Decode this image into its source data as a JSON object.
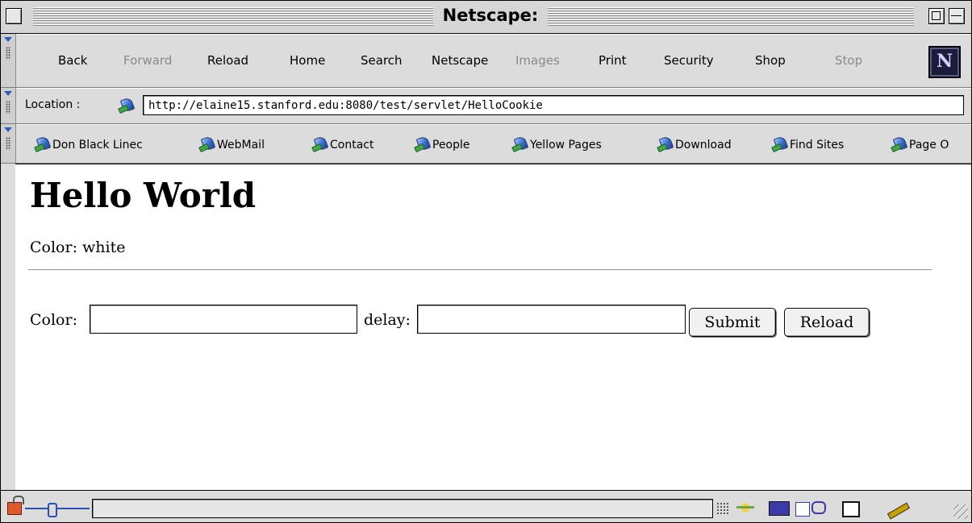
{
  "window": {
    "title": "Netscape:"
  },
  "nav_toolbar": {
    "buttons": [
      {
        "label": "Back",
        "enabled": true
      },
      {
        "label": "Forward",
        "enabled": false
      },
      {
        "label": "Reload",
        "enabled": true
      },
      {
        "label": "Home",
        "enabled": true
      },
      {
        "label": "Search",
        "enabled": true
      },
      {
        "label": "Netscape",
        "enabled": true
      },
      {
        "label": "Images",
        "enabled": false
      },
      {
        "label": "Print",
        "enabled": true
      },
      {
        "label": "Security",
        "enabled": true
      },
      {
        "label": "Shop",
        "enabled": true
      },
      {
        "label": "Stop",
        "enabled": false
      }
    ],
    "logo_letter": "N"
  },
  "location_bar": {
    "label": "Location :",
    "url": "http://elaine15.stanford.edu:8080/test/servlet/HelloCookie"
  },
  "personal_toolbar": {
    "items": [
      {
        "label": "Don Black Linec"
      },
      {
        "label": "WebMail"
      },
      {
        "label": "Contact"
      },
      {
        "label": "People"
      },
      {
        "label": "Yellow Pages"
      },
      {
        "label": "Download"
      },
      {
        "label": "Find Sites"
      },
      {
        "label": "Page O"
      }
    ]
  },
  "page": {
    "heading": "Hello World",
    "color_line": "Color: white",
    "form": {
      "color_label": "Color:",
      "color_value": "",
      "delay_label": "delay:",
      "delay_value": "",
      "submit_label": "Submit",
      "reload_label": "Reload"
    }
  },
  "status_bar": {
    "status_text": ""
  }
}
